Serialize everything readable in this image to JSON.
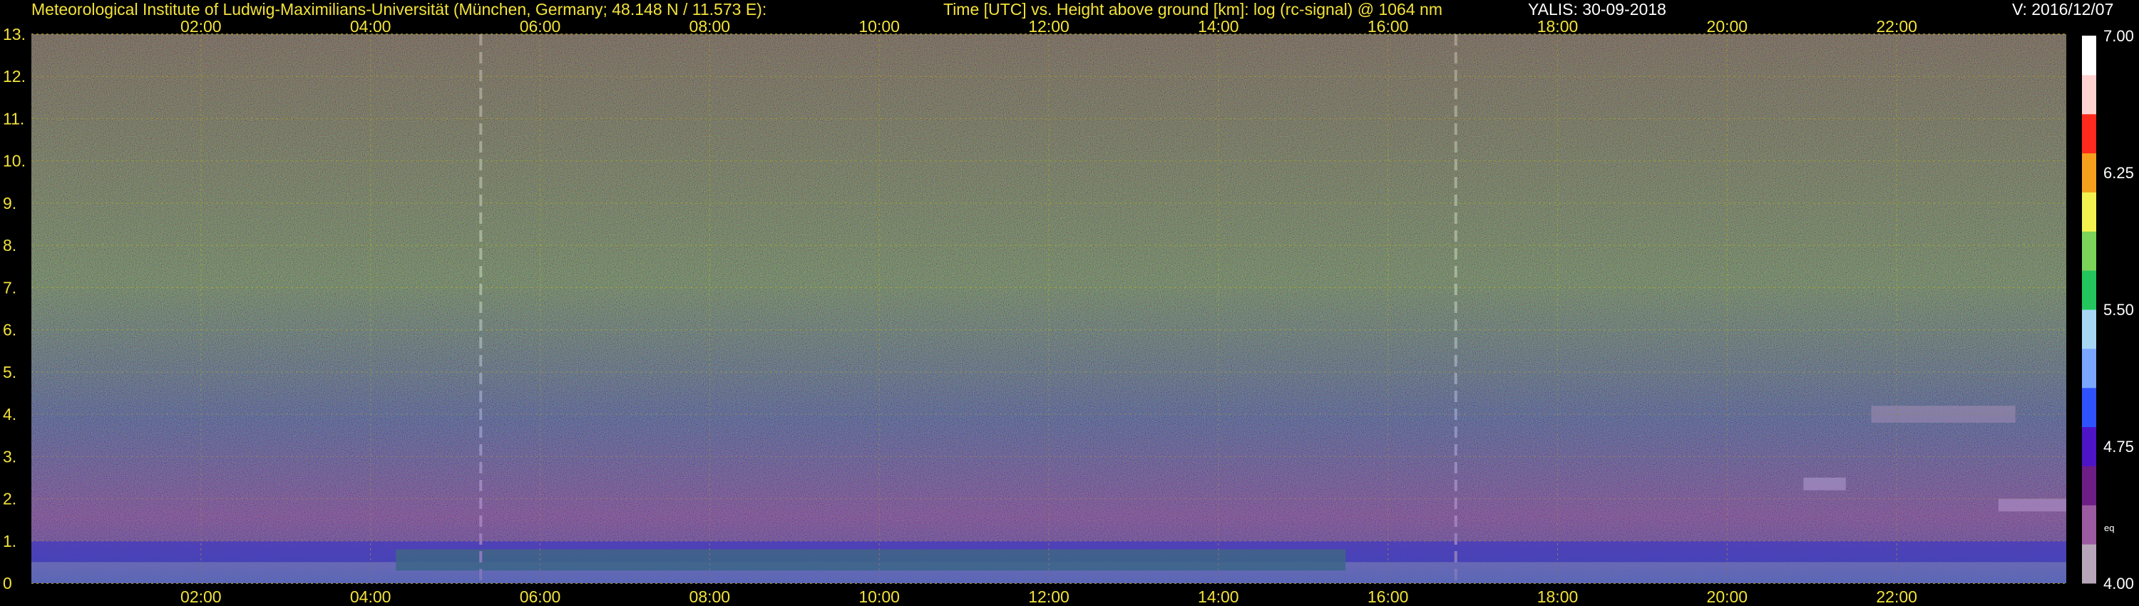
{
  "header": {
    "institute": "Meteorological Institute of Ludwig-Maximilians-Universität (München, Germany; 48.148 N / 11.573 E):",
    "plot_title": "Time [UTC] vs. Height above ground [km]: log (rc-signal) @ 1064 nm",
    "instrument_date": "YALIS: 30-09-2018",
    "version": "V: 2016/12/07"
  },
  "colorbar": {
    "tick_labels": [
      "7.00",
      "6.25",
      "5.50",
      "4.75",
      "4.00"
    ],
    "tick_values": [
      7.0,
      6.25,
      5.5,
      4.75,
      4.0
    ],
    "unit_label": "eq",
    "colors": [
      "#b7a6b9",
      "#9c5aa0",
      "#6d1e84",
      "#4d14c8",
      "#2f52ff",
      "#7aa6ff",
      "#a6d8f4",
      "#22c65d",
      "#7cd35a",
      "#f3f14e",
      "#f5a01c",
      "#ff2a1d",
      "#ffd2d2",
      "#ffffff"
    ]
  },
  "chart_data": {
    "type": "heatmap",
    "title": "Time [UTC] vs. Height above ground [km]: log (rc-signal) @ 1064 nm",
    "xlabel": "Time [UTC]",
    "ylabel": "Height above ground [km]",
    "x_tick_labels": [
      "02:00",
      "04:00",
      "06:00",
      "08:00",
      "10:00",
      "12:00",
      "14:00",
      "16:00",
      "18:00",
      "20:00",
      "22:00"
    ],
    "x_tick_hours": [
      2,
      4,
      6,
      8,
      10,
      12,
      14,
      16,
      18,
      20,
      22
    ],
    "xlim_hours": [
      0,
      24
    ],
    "y_tick_labels": [
      "0",
      "1.",
      "2.",
      "3.",
      "4.",
      "5.",
      "6.",
      "7.",
      "8.",
      "9.",
      "10.",
      "11.",
      "12.",
      "13."
    ],
    "y_ticks_km": [
      0,
      1,
      2,
      3,
      4,
      5,
      6,
      7,
      8,
      9,
      10,
      11,
      12,
      13
    ],
    "ylim_km": [
      0,
      13
    ],
    "zlim": [
      4.0,
      7.0
    ],
    "grid": true,
    "dashed_markers_hours": [
      5.3,
      16.8
    ],
    "features": [
      {
        "kind": "near-surface layer",
        "start_h": 0.0,
        "end_h": 24.0,
        "bottom_km": 0.0,
        "top_km": 0.5,
        "value": 5.4
      },
      {
        "kind": "aerosol layer",
        "start_h": 0.0,
        "end_h": 24.0,
        "bottom_km": 0.5,
        "top_km": 1.0,
        "value": 4.9
      },
      {
        "kind": "green boundary layer",
        "start_h": 4.3,
        "end_h": 15.5,
        "bottom_km": 0.3,
        "top_km": 0.8,
        "value": 5.7
      },
      {
        "kind": "cloud",
        "start_h": 21.7,
        "end_h": 23.4,
        "bottom_km": 3.8,
        "top_km": 4.2,
        "value": 6.8
      },
      {
        "kind": "cloud",
        "start_h": 20.9,
        "end_h": 21.4,
        "bottom_km": 2.2,
        "top_km": 2.5,
        "value": 7.0
      },
      {
        "kind": "cloud",
        "start_h": 23.2,
        "end_h": 24.0,
        "bottom_km": 1.7,
        "top_km": 2.0,
        "value": 7.0
      }
    ]
  }
}
